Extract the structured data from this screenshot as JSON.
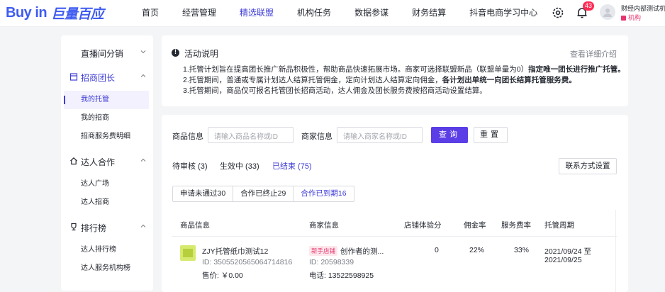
{
  "brand": {
    "logo_text": "Buy in",
    "logo_text_cn": "巨量百应"
  },
  "nav": [
    "首页",
    "经营管理",
    "精选联盟",
    "机构任务",
    "数据参谋",
    "财务结算",
    "抖音电商学习中心"
  ],
  "nav_active": "精选联盟",
  "notifications": {
    "count": "43"
  },
  "account": {
    "name": "财经内部测试机",
    "role": "机构"
  },
  "sidebar": {
    "groups": [
      {
        "label": "直播间分销",
        "icon": ""
      },
      {
        "label": "招商团长",
        "icon": "building-icon"
      },
      {
        "label": "达人合作",
        "icon": "home-icon"
      },
      {
        "label": "排行榜",
        "icon": "trophy-icon"
      }
    ],
    "items": [
      "我的托管",
      "我的招商",
      "招商服务费明细",
      "达人广场",
      "达人招商",
      "达人排行榜",
      "达人服务机构榜"
    ]
  },
  "activity": {
    "title": "活动说明",
    "more": "查看详细介绍",
    "line1_a": "1.托管计划旨在提高团长推广新品积极性，帮助商品快速拓展市场。商家可选择联盟新品（联盟单量为0）",
    "line1_b": "指定唯一团长进行推广托管。",
    "line2_a": "2.托管期间，普通或专属计划达人结算托管佣金，定向计划达人结算定向佣金，",
    "line2_b": "各计划出单统一向团长结算托管服务费。",
    "line3": "3.托管期间，商品仅可报名托管团长招商活动，达人佣金及团长服务费按招商活动设置结算。"
  },
  "filters": {
    "goods_label": "商品信息",
    "goods_placeholder": "请输入商品名称或ID",
    "shop_label": "商家信息",
    "shop_placeholder": "请输入商家名称或ID",
    "query": "查询",
    "reset": "重置"
  },
  "tabs": [
    "待审核 (3)",
    "生效中 (33)",
    "已结束 (75)"
  ],
  "tab_active": "已结束 (75)",
  "contact_btn": "联系方式设置",
  "segments": [
    "申请未通过30",
    "合作已终止29",
    "合作已到期16"
  ],
  "segment_active": "合作已到期16",
  "table": {
    "headers": [
      "商品信息",
      "商家信息",
      "店铺体验分",
      "佣金率",
      "服务费率",
      "托管周期"
    ],
    "rows": [
      {
        "goods_name": "ZJY托管纸巾测试12",
        "goods_id": "ID: 3505520565064714816",
        "price": "售价: ￥0.00",
        "shop_tag": "新手店铺",
        "shop_name": "创作者的测...",
        "shop_id": "ID: 20598339",
        "phone": "电话: 13522598925",
        "score": "0",
        "commission": "22%",
        "service_fee": "33%",
        "period_start": "2021/09/24 至",
        "period_end": "2021/09/25"
      }
    ]
  },
  "colors": {
    "accent": "#3f3dd6",
    "brand_blue": "#3f5cf0",
    "badge": "#fe2c55",
    "button": "#5b3ee6"
  }
}
